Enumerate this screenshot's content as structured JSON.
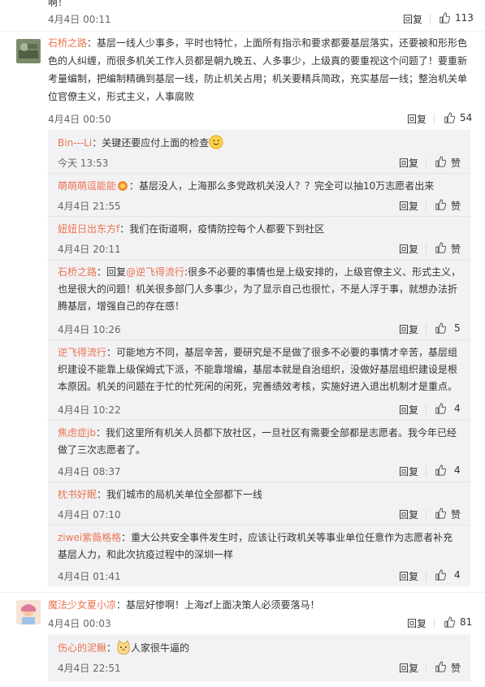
{
  "top_fragment": {
    "text": "啊！",
    "time": "4月4日 00:11",
    "reply": "回复",
    "likes": "113"
  },
  "comments": [
    {
      "user": "石桥之路",
      "text": "：基层一线人少事多，平时也特忙，上面所有指示和要求都要基层落实，还要被和形形色色的人纠缠，而很多机关工作人员都是朝九晚五、人多事少，上级真的要重视这个问题了！要重新考量编制，把编制精确到基层一线，防止机关占用；机关要精兵简政，充实基层一线；整治机关单位官僚主义，形式主义，人事腐败",
      "time": "4月4日 00:50",
      "reply": "回复",
      "likes": "54",
      "replies": [
        {
          "user": "Bin---Li",
          "text": "：关键还要应付上面的检查",
          "time": "今天 13:53",
          "reply": "回复",
          "likes": "赞"
        },
        {
          "user": "萌萌萌逗能能",
          "text": "：基层没人，上海那么多党政机关没人？？完全可以抽10万志愿者出来",
          "time": "4月4日 21:55",
          "reply": "回复",
          "likes": "赞"
        },
        {
          "user": "妞妞日出东方f",
          "text": "：我们在街道啊，疫情防控每个人都要下到社区",
          "time": "4月4日 20:11",
          "reply": "回复",
          "likes": "赞"
        },
        {
          "user": "石桥之路",
          "prefix": "：回复",
          "mention": "@逆飞得流行",
          "text": ":很多不必要的事情也是上级安排的，上级官僚主义、形式主义，也是很大的问题！机关很多部门人多事少，为了显示自己也很忙，不是人浮于事，就想办法折腾基层，增强自己的存在感！",
          "time": "4月4日 10:26",
          "reply": "回复",
          "likes": "5"
        },
        {
          "user": "逆飞得流行",
          "text": "：可能地方不同，基层辛苦，要研究是不是做了很多不必要的事情才辛苦，基层组织建设不能靠上级保姆式下派，不能靠增编，基层本就是自治组织，没做好基层组织建设是根本原因。机关的问题在于忙的忙死闲的闲死，完善绩效考核，实施好进入退出机制才是重点。",
          "time": "4月4日 10:22",
          "reply": "回复",
          "likes": "4"
        },
        {
          "user": "焦虑症jb",
          "text": "：我们这里所有机关人员都下放社区，一旦社区有需要全部都是志愿者。我今年已经做了三次志愿者了。",
          "time": "4月4日 08:37",
          "reply": "回复",
          "likes": "4"
        },
        {
          "user": "枕书好眠",
          "text": "：我们城市的局机关单位全部都下一线",
          "time": "4月4日 07:10",
          "reply": "回复",
          "likes": "赞"
        },
        {
          "user": "ziwei紫薇格格",
          "text": "：重大公共安全事件发生时，应该让行政机关等事业单位任意作为志愿者补充基层人力，和此次抗疫过程中的深圳一样",
          "time": "4月4日 01:41",
          "reply": "回复",
          "likes": "4"
        }
      ]
    },
    {
      "user": "魔法少女夏小凉",
      "text": "：基层好惨啊！上海zf上面决策人必须要落马！",
      "time": "4月4日 00:03",
      "reply": "回复",
      "likes": "81",
      "replies": [
        {
          "user": "伤心的泥鳅",
          "text": "：",
          "text2": "人家很牛逼的",
          "time": "4月4日 22:51",
          "reply": "回复",
          "likes": "赞"
        }
      ]
    }
  ],
  "colors": {
    "username": "#eb7350",
    "subbox_bg": "#f2f2f5",
    "text": "#333333",
    "meta": "#666666"
  },
  "icons": {
    "thumb": "thumb-up-icon",
    "emoji_smile": "smile-emoji-icon",
    "emoji_cat": "cat-emoji-icon"
  }
}
